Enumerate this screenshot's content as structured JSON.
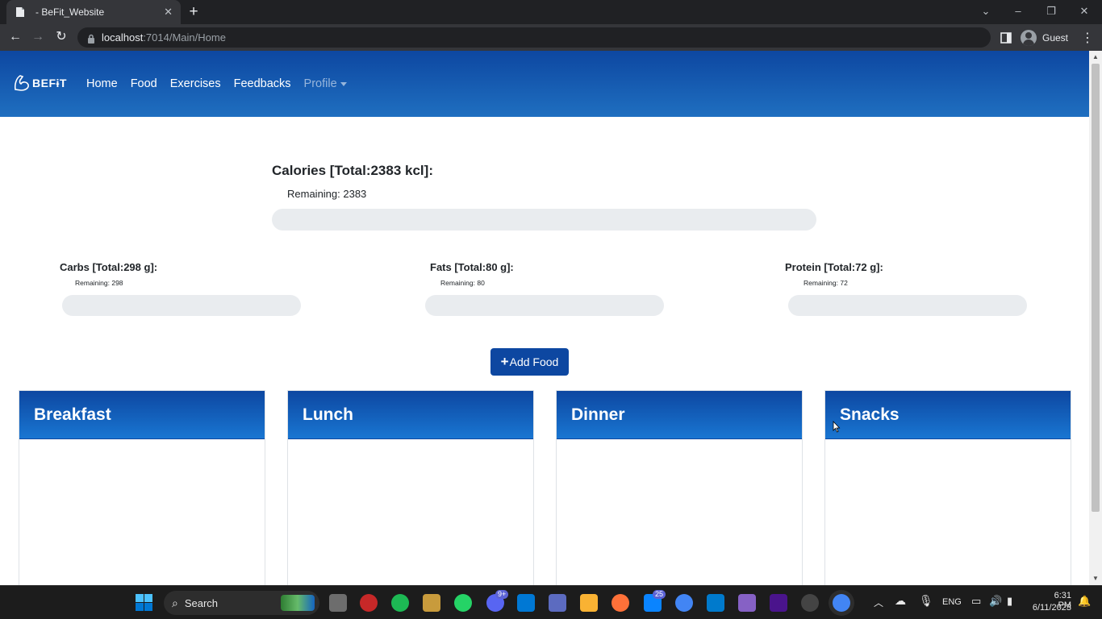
{
  "browser": {
    "tab_title": "- BeFit_Website",
    "url_host": "localhost",
    "url_path": ":7014/Main/Home",
    "profile_label": "Guest"
  },
  "navbar": {
    "logo_text": "BEF",
    "logo_text2": "T",
    "links": [
      "Home",
      "Food",
      "Exercises",
      "Feedbacks"
    ],
    "profile_label": "Profile"
  },
  "calories": {
    "title": "Calories [Total:2383 kcl]:",
    "remaining_label": "Remaining: 2383",
    "progress": 0
  },
  "macros": {
    "carbs": {
      "title": "Carbs [Total:298 g]:",
      "remaining_label": "Remaining: 298",
      "progress": 0
    },
    "fats": {
      "title": "Fats [Total:80 g]:",
      "remaining_label": "Remaining: 80",
      "progress": 0
    },
    "protein": {
      "title": "Protein [Total:72 g]:",
      "remaining_label": "Remaining: 72",
      "progress": 0
    }
  },
  "add_food_label": "Add Food",
  "meals": [
    "Breakfast",
    "Lunch",
    "Dinner",
    "Snacks"
  ],
  "taskbar": {
    "search_label": "Search",
    "lang": "ENG",
    "time": "6:31 PM",
    "date": "6/11/2023",
    "discord_badge": "9+",
    "mail_badge": "25"
  },
  "colors": {
    "brand_primary": "#0d47a1",
    "brand_secondary": "#1f6fc0",
    "progress_track": "#e9ecef"
  }
}
